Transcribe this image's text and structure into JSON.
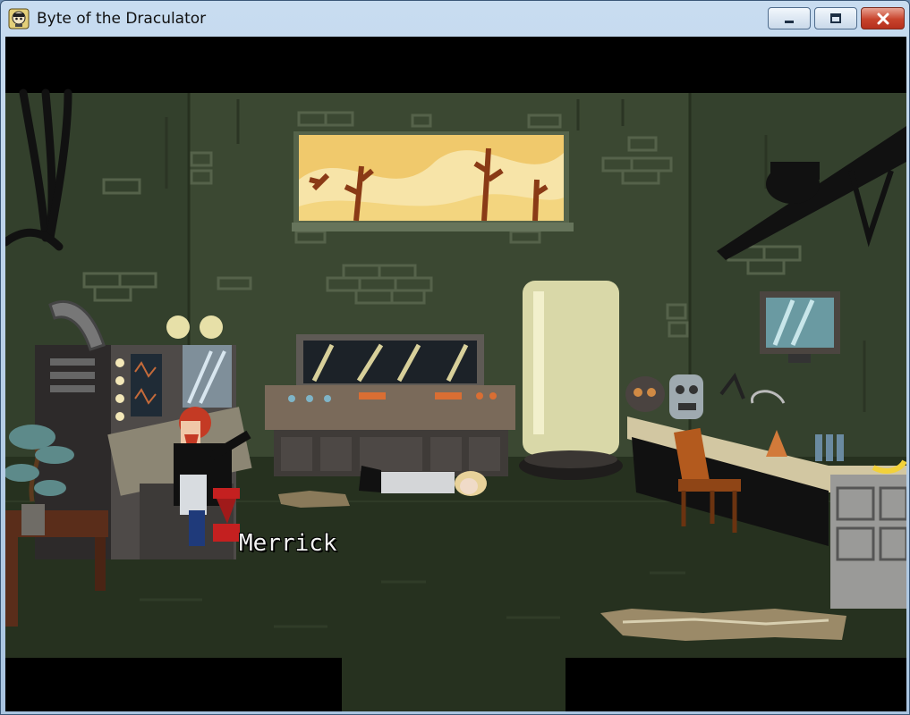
{
  "window": {
    "title": "Byte of the Draculator",
    "controls": {
      "minimize": "minimize-icon",
      "maximize": "maximize-icon",
      "close": "close-icon"
    }
  },
  "game": {
    "speech_label": "Merrick",
    "colors": {
      "wall": "#3d4a33",
      "floor": "#25301f",
      "window_sky": "#f0c96c",
      "speech_text": "#f2f2f2"
    }
  }
}
